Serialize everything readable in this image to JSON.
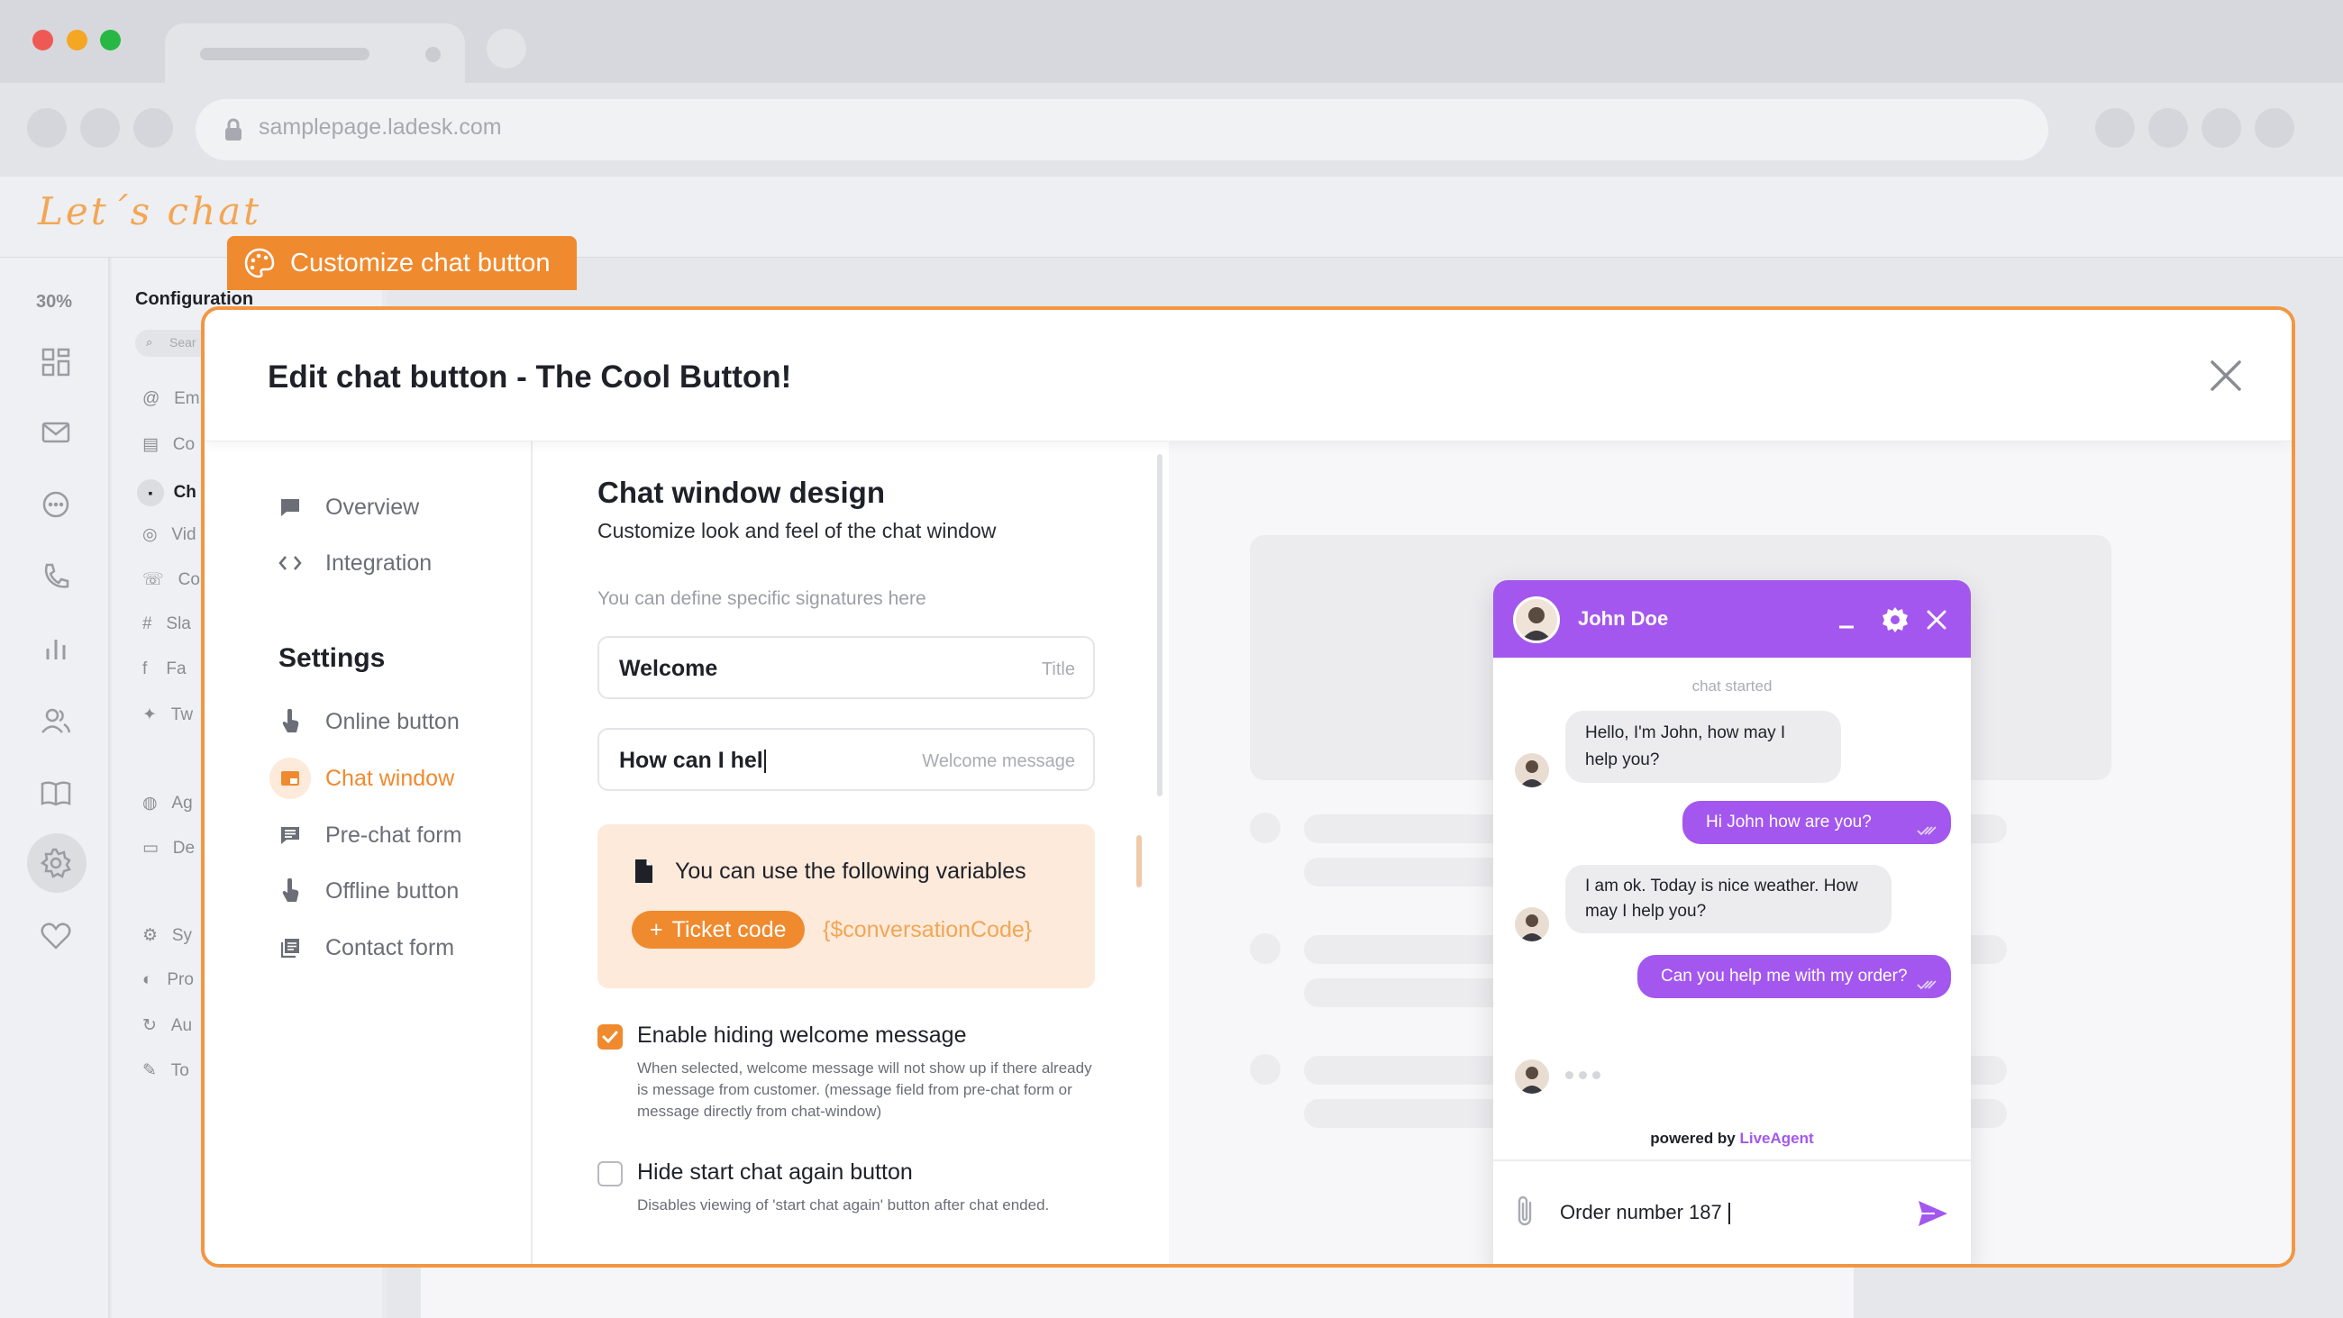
{
  "browser": {
    "url": "samplepage.ladesk.com",
    "traffic_colors": [
      "#ee5a53",
      "#f5a623",
      "#27b844"
    ]
  },
  "app": {
    "logo": "Let´s chat",
    "rail_percent": "30%",
    "config_title": "Configuration",
    "config_search_placeholder": "Sear",
    "config_items": [
      "Em",
      "Co",
      "Ch",
      "Vid",
      "Co",
      "Sla",
      "Fa",
      "Tw",
      "Ag",
      "De",
      "Sy",
      "Pro",
      "Au",
      "To"
    ]
  },
  "customize_tag": {
    "label": "Customize chat button"
  },
  "modal": {
    "title": "Edit chat button - The Cool Button!",
    "nav": {
      "overview": "Overview",
      "integration": "Integration",
      "settings_heading": "Settings",
      "online_button": "Online button",
      "chat_window": "Chat window",
      "prechat_form": "Pre-chat form",
      "offline_button": "Offline button",
      "contact_form": "Contact form"
    },
    "form": {
      "title": "Chat window design",
      "subtitle": "Customize look and feel of the chat window",
      "hint": "You can define specific signatures here",
      "title_field": {
        "value": "Welcome",
        "label": "Title"
      },
      "welcome_field": {
        "value": "How can I hel",
        "label": "Welcome message"
      },
      "variables": {
        "title": "You can use the following variables",
        "pill": "Ticket code",
        "code": "{$conversationCode}"
      },
      "enable_hiding": {
        "checked": true,
        "label": "Enable hiding welcome message",
        "description": "When selected, welcome message will not show up if there already is message from customer. (message field from pre-chat form or message directly from chat-window)"
      },
      "hide_restart": {
        "checked": false,
        "label": "Hide start chat again button",
        "description": "Disables viewing of 'start chat again' button after chat ended."
      }
    }
  },
  "chat_preview": {
    "agent_name": "John Doe",
    "status": "chat started",
    "messages": [
      {
        "from": "agent",
        "text": "Hello, I'm John, how may I help you?"
      },
      {
        "from": "visitor",
        "text": "Hi John how are you?"
      },
      {
        "from": "agent",
        "text": "I am ok. Today is nice weather. How may I help you?"
      },
      {
        "from": "visitor",
        "text": "Can you help me with my order?"
      }
    ],
    "powered_prefix": "powered by",
    "powered_brand": "LiveAgent",
    "input_value": "Order number 187",
    "accent": "#a357ee"
  },
  "colors": {
    "accent": "#f08a2e",
    "purple": "#a357ee"
  }
}
